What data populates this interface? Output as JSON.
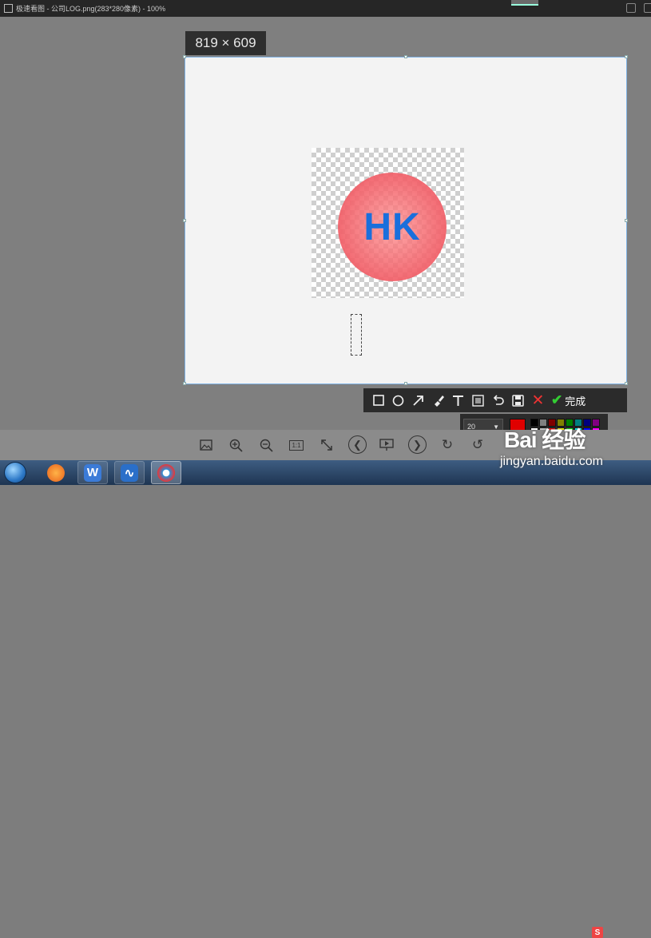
{
  "titlebar": {
    "title": "极速看图 - 公司LOG.png(283*280像素) - 100%"
  },
  "selection": {
    "size_label": "819 × 609"
  },
  "image": {
    "logo_text": "HK",
    "logo_colors": {
      "circle": "#f05a64",
      "text": "#1a6fdc"
    }
  },
  "toolbar": {
    "tools": [
      {
        "name": "rectangle",
        "icon": "rectangle-icon"
      },
      {
        "name": "ellipse",
        "icon": "ellipse-icon"
      },
      {
        "name": "arrow",
        "icon": "arrow-icon"
      },
      {
        "name": "brush",
        "icon": "brush-icon"
      },
      {
        "name": "text",
        "icon": "text-icon"
      },
      {
        "name": "mosaic",
        "icon": "mosaic-icon"
      },
      {
        "name": "undo",
        "icon": "undo-icon"
      },
      {
        "name": "save",
        "icon": "save-icon"
      },
      {
        "name": "cancel",
        "icon": "close-icon"
      }
    ],
    "done_label": "完成"
  },
  "style_panel": {
    "font_size": "20",
    "current_color": "#e00000",
    "palette": [
      "#000000",
      "#808080",
      "#800000",
      "#808000",
      "#008000",
      "#008080",
      "#000080",
      "#800080",
      "#ffffff",
      "#c0c0c0",
      "#ff0000",
      "#ffff00",
      "#00ff00",
      "#00ffff",
      "#0000ff",
      "#ff00ff"
    ]
  },
  "viewbar": {
    "buttons": [
      "image-icon",
      "zoom-in-icon",
      "zoom-out-icon",
      "actual-size-icon",
      "fit-icon",
      "prev-icon",
      "slideshow-icon",
      "next-icon",
      "rotate-right-icon",
      "rotate-left-icon"
    ],
    "actual_size_label": "1:1"
  },
  "taskbar": {
    "apps": [
      "start-orb",
      "firefox-icon",
      "wps-icon",
      "app-icon",
      "viewer-icon"
    ]
  },
  "watermark": {
    "brand": "Bai 经验",
    "url": "jingyan.baidu.com"
  }
}
